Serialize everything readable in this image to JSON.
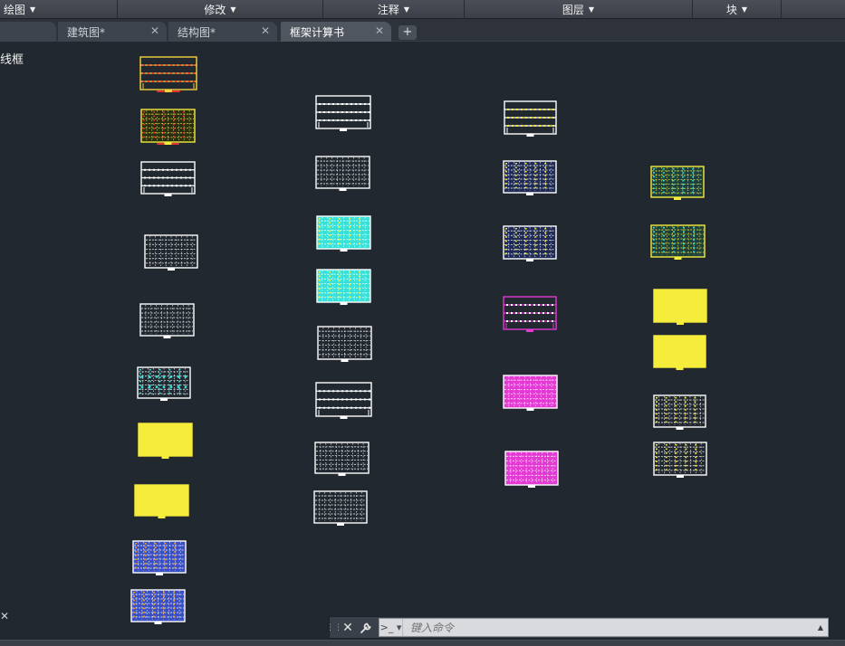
{
  "ribbon_panels": [
    {
      "label": "绘图",
      "name": "draw"
    },
    {
      "label": "修改",
      "name": "modify"
    },
    {
      "label": "注释",
      "name": "annotate"
    },
    {
      "label": "图层",
      "name": "layers"
    },
    {
      "label": "块",
      "name": "block"
    },
    {
      "label": "",
      "name": "extra"
    }
  ],
  "tabs": [
    {
      "label": "",
      "name": "start"
    },
    {
      "label": "建筑图*",
      "name": "architectural"
    },
    {
      "label": "结构图*",
      "name": "structural"
    },
    {
      "label": "框架计算书",
      "name": "frame-calc",
      "active": true
    }
  ],
  "tab_close_glyph": "✕",
  "new_tab_glyph": "+",
  "viewport_label": "线框",
  "command_line": {
    "placeholder": "键入命令",
    "close_glyph": "✕",
    "wrench_glyph": "🔧",
    "prompt_glyph": ">_ ▾",
    "history_glyph": "▲"
  },
  "colors": {
    "background": "#212830",
    "white": "#ffffff",
    "yellow": "#f5ec3c",
    "cyan": "#39e0d8",
    "magenta": "#e23ad2",
    "blue": "#3a4fc4",
    "red": "#e23030",
    "orange": "#f2a20d"
  },
  "drawing_sheets": [
    {
      "style": "orange-yellow",
      "stroke": "#f5d23c",
      "fill": "none",
      "accent": "#e23030"
    },
    {
      "style": "yellow-grid",
      "stroke": "#f5ec3c",
      "fill": "#2a2f10",
      "accent": "#e23030"
    },
    {
      "style": "white-plan",
      "stroke": "#ffffff",
      "fill": "none",
      "accent": ""
    },
    {
      "style": "white-dense",
      "stroke": "#ffffff",
      "fill": "none",
      "accent": ""
    },
    {
      "style": "white-dense",
      "stroke": "#ffffff",
      "fill": "none",
      "accent": ""
    },
    {
      "style": "white-dots-cyan",
      "stroke": "#ffffff",
      "fill": "none",
      "accent": "#39e0d8"
    },
    {
      "style": "yellow-fill",
      "stroke": "#f5ec3c",
      "fill": "#f5ec3c",
      "accent": ""
    },
    {
      "style": "yellow-fill",
      "stroke": "#f5ec3c",
      "fill": "#f5ec3c",
      "accent": ""
    },
    {
      "style": "blue-grid",
      "stroke": "#ffffff",
      "fill": "#3a4fc4",
      "accent": "#f2a20d"
    },
    {
      "style": "blue-grid",
      "stroke": "#ffffff",
      "fill": "#3a4fc4",
      "accent": "#f2a20d"
    },
    {
      "style": "white-plan",
      "stroke": "#ffffff",
      "fill": "none",
      "accent": ""
    },
    {
      "style": "white-dense",
      "stroke": "#ffffff",
      "fill": "none",
      "accent": ""
    },
    {
      "style": "cyan-fill",
      "stroke": "#ffffff",
      "fill": "#39e0d8",
      "accent": "#f5ec3c"
    },
    {
      "style": "cyan-fill",
      "stroke": "#ffffff",
      "fill": "#39e0d8",
      "accent": "#f5ec3c"
    },
    {
      "style": "white-dense",
      "stroke": "#ffffff",
      "fill": "none",
      "accent": ""
    },
    {
      "style": "white-plan",
      "stroke": "#ffffff",
      "fill": "none",
      "accent": ""
    },
    {
      "style": "white-dense",
      "stroke": "#ffffff",
      "fill": "none",
      "accent": ""
    },
    {
      "style": "white-dense",
      "stroke": "#ffffff",
      "fill": "none",
      "accent": ""
    },
    {
      "style": "white-plan-yellow",
      "stroke": "#ffffff",
      "fill": "none",
      "accent": "#f5ec3c"
    },
    {
      "style": "white-blue-dense",
      "stroke": "#ffffff",
      "fill": "#1f2a55",
      "accent": "#f5ec3c"
    },
    {
      "style": "white-blue-dense",
      "stroke": "#ffffff",
      "fill": "#1f2a55",
      "accent": "#f5ec3c"
    },
    {
      "style": "magenta-plan",
      "stroke": "#e23ad2",
      "fill": "none",
      "accent": "#ffffff"
    },
    {
      "style": "magenta-fill",
      "stroke": "#ffffff",
      "fill": "#e23ad2",
      "accent": ""
    },
    {
      "style": "magenta-fill",
      "stroke": "#ffffff",
      "fill": "#e23ad2",
      "accent": ""
    },
    {
      "style": "cyan-yellow",
      "stroke": "#f5ec3c",
      "fill": "#1d3f3d",
      "accent": "#39e0d8"
    },
    {
      "style": "cyan-yellow",
      "stroke": "#f5ec3c",
      "fill": "#1d3f3d",
      "accent": "#39e0d8"
    },
    {
      "style": "yellow-fill",
      "stroke": "#f5ec3c",
      "fill": "#f5ec3c",
      "accent": ""
    },
    {
      "style": "yellow-fill",
      "stroke": "#f5ec3c",
      "fill": "#f5ec3c",
      "accent": ""
    },
    {
      "style": "white-yellow-dense",
      "stroke": "#ffffff",
      "fill": "none",
      "accent": "#f5ec3c"
    },
    {
      "style": "white-yellow-dense",
      "stroke": "#ffffff",
      "fill": "none",
      "accent": "#f5ec3c"
    }
  ]
}
